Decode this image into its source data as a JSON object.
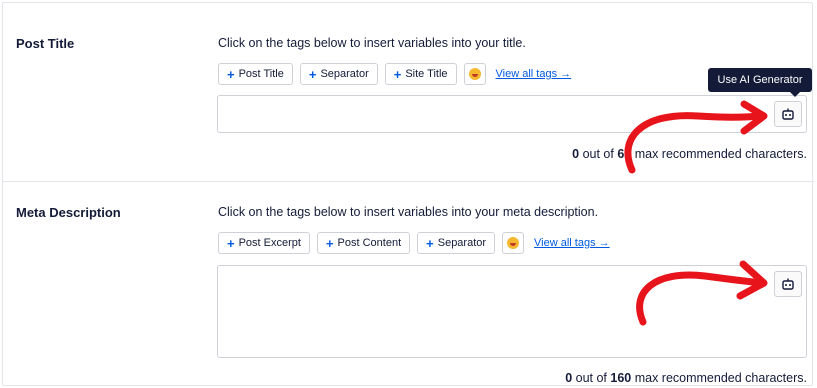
{
  "post_title": {
    "label": "Post Title",
    "instructions": "Click on the tags below to insert variables into your title.",
    "tags": [
      "Post Title",
      "Separator",
      "Site Title"
    ],
    "view_all": "View all tags →",
    "counter": {
      "count": "0",
      "text_mid": " out of ",
      "max": "60",
      "text_end": " max recommended characters."
    }
  },
  "meta_description": {
    "label": "Meta Description",
    "instructions": "Click on the tags below to insert variables into your meta description.",
    "tags": [
      "Post Excerpt",
      "Post Content",
      "Separator"
    ],
    "view_all": "View all tags →",
    "counter": {
      "count": "0",
      "text_mid": " out of ",
      "max": "160",
      "text_end": " max recommended characters."
    }
  },
  "tooltip": "Use AI Generator",
  "icons": {
    "tag_plus": "plus-icon",
    "emoji": "emoji-icon",
    "ai": "robot-icon",
    "annotation": "red-arrow-icon"
  },
  "colors": {
    "accent": "#005ae0",
    "text": "#141b38",
    "tooltip_bg": "#141b38",
    "arrow": "#e8141c"
  }
}
